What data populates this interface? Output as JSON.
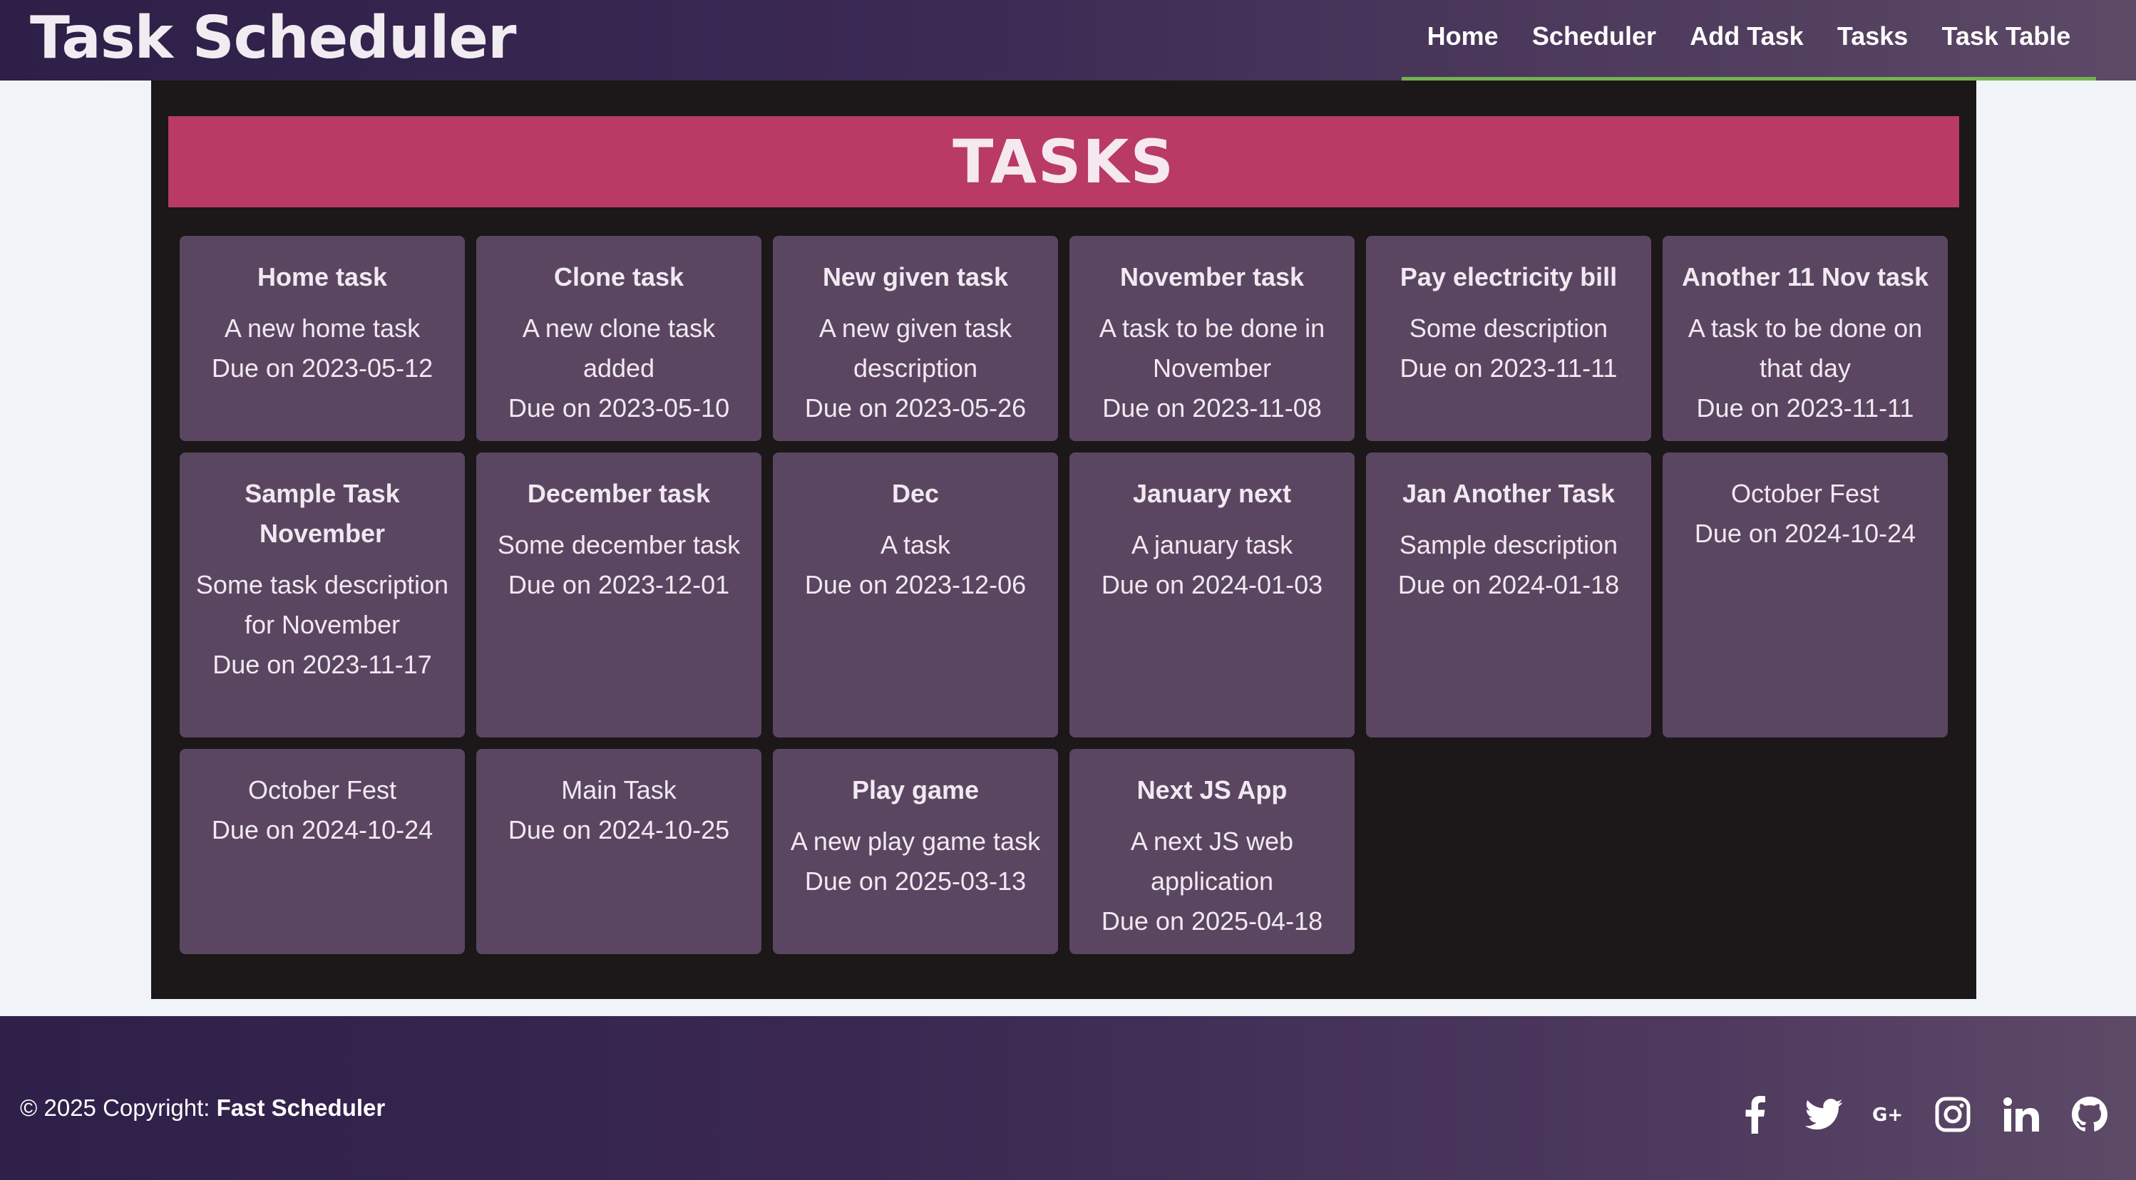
{
  "header": {
    "brand": "Task Scheduler",
    "nav": [
      "Home",
      "Scheduler",
      "Add Task",
      "Tasks",
      "Task Table"
    ],
    "active_underline_color": "#74b153"
  },
  "page": {
    "heading": "TASKS",
    "banner_color": "#b83a65"
  },
  "tasks": [
    {
      "title": "Home task",
      "description": "A new home task",
      "due": "Due on 2023-05-12"
    },
    {
      "title": "Clone task",
      "description": "A new clone task added",
      "due": "Due on 2023-05-10"
    },
    {
      "title": "New given task",
      "description": "A new given task description",
      "due": "Due on 2023-05-26"
    },
    {
      "title": "November task",
      "description": "A task to be done in November",
      "due": "Due on 2023-11-08"
    },
    {
      "title": "Pay electricity bill",
      "description": "Some description",
      "due": "Due on 2023-11-11"
    },
    {
      "title": "Another 11 Nov task",
      "description": "A task to be done on that day",
      "due": "Due on 2023-11-11"
    },
    {
      "title": "Sample Task November",
      "description": "Some task description for November",
      "due": "Due on 2023-11-17"
    },
    {
      "title": "December task",
      "description": "Some december task",
      "due": "Due on 2023-12-01"
    },
    {
      "title": "Dec",
      "description": "A task",
      "due": "Due on 2023-12-06"
    },
    {
      "title": "January next",
      "description": "A january task",
      "due": "Due on 2024-01-03"
    },
    {
      "title": "Jan Another Task",
      "description": "Sample description",
      "due": "Due on 2024-01-18"
    },
    {
      "title": "",
      "description": "October Fest",
      "due": "Due on 2024-10-24"
    },
    {
      "title": "",
      "description": "October Fest",
      "due": "Due on 2024-10-24"
    },
    {
      "title": "",
      "description": "Main Task",
      "due": "Due on 2024-10-25"
    },
    {
      "title": "Play game",
      "description": "A new play game task",
      "due": "Due on 2025-03-13"
    },
    {
      "title": "Next JS App",
      "description": "A next JS web application",
      "due": "Due on 2025-04-18"
    }
  ],
  "footer": {
    "copyright_prefix": "© 2025 Copyright: ",
    "copyright_owner": "Fast Scheduler",
    "social": [
      "facebook-icon",
      "twitter-icon",
      "google-plus-icon",
      "instagram-icon",
      "linkedin-icon",
      "github-icon"
    ]
  }
}
